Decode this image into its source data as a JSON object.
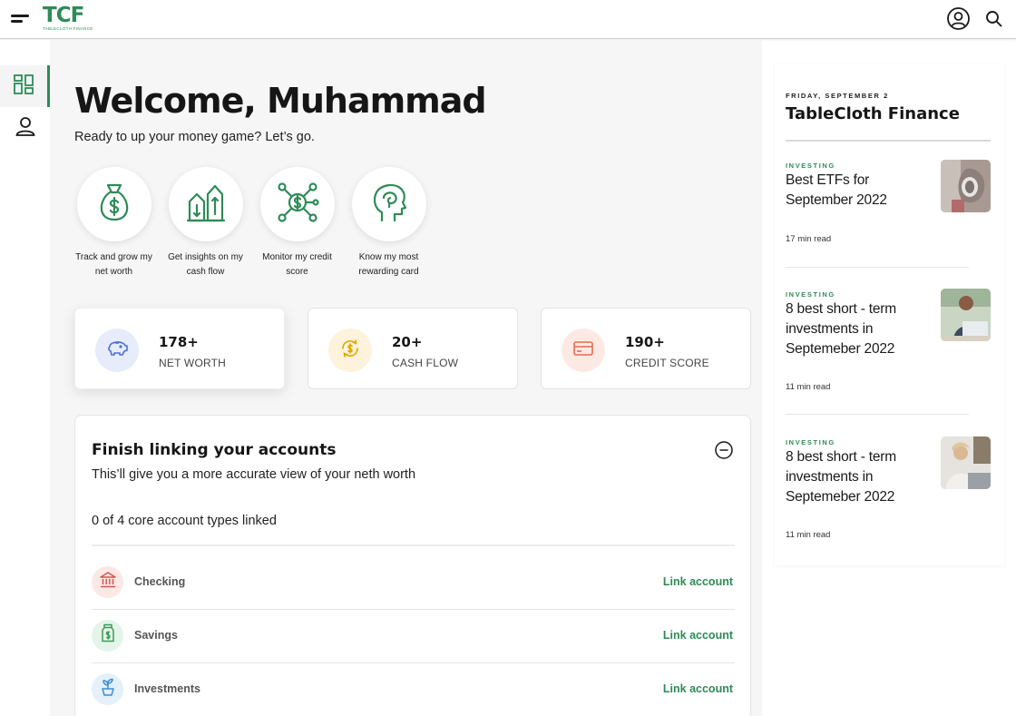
{
  "header": {
    "logo_text": "TCF",
    "logo_subtext": "TABLECLOTH FINANCE"
  },
  "sidebar": {
    "items": [
      {
        "icon": "dashboard-icon",
        "active": true
      },
      {
        "icon": "user-icon",
        "active": false
      }
    ]
  },
  "main": {
    "welcome": "Welcome, Muhammad",
    "subtitle": "Ready to up your money game? Let’s go.",
    "features": [
      {
        "icon": "money-bag-icon",
        "label": "Track and grow my net worth"
      },
      {
        "icon": "buildings-growth-icon",
        "label": "Get insights on my cash flow"
      },
      {
        "icon": "coin-network-icon",
        "label": "Monitor my credit score"
      },
      {
        "icon": "head-brain-icon",
        "label": "Know my most rewarding card"
      }
    ],
    "stats": [
      {
        "value": "178+",
        "label": "NET WORTH",
        "icon": "piggy-bank-icon",
        "color": "#4a6fd6",
        "bg": "#e7ecfa"
      },
      {
        "value": "20+",
        "label": "CASH FLOW",
        "icon": "coin-cycle-icon",
        "color": "#e0a800",
        "bg": "#fdf3dc"
      },
      {
        "value": "190+",
        "label": "CREDIT SCORE",
        "icon": "credit-card-icon",
        "color": "#e56a4f",
        "bg": "#fde9e4"
      }
    ]
  },
  "linking": {
    "title": "Finish linking your accounts",
    "subtitle": "This’ll give you a more accurate view of your neth worth",
    "progress": "0 of 4 core account types linked",
    "accounts": [
      {
        "name": "Checking",
        "action": "Link account",
        "icon": "bank-icon",
        "color": "#d9534f",
        "bg": "#fde8e6"
      },
      {
        "name": "Savings",
        "action": "Link account",
        "icon": "money-jar-icon",
        "color": "#3d9a5c",
        "bg": "#e5f4e8"
      },
      {
        "name": "Investments",
        "action": "Link account",
        "icon": "plant-growth-icon",
        "color": "#3b8fd0",
        "bg": "#e4f0fa"
      }
    ]
  },
  "news": {
    "date": "FRIDAY, SEPTEMBER 2",
    "title": "TableCloth Finance",
    "articles": [
      {
        "category": "INVESTING",
        "title": "Best ETFs for September 2022",
        "meta": "17 min read"
      },
      {
        "category": "INVESTING",
        "title": "8 best short - term investments in Septemeber 2022",
        "meta": "11 min read"
      },
      {
        "category": "INVESTING",
        "title": "8 best short - term investments in Septemeber 2022",
        "meta": "11 min read"
      }
    ]
  },
  "colors": {
    "brand": "#2e8b57",
    "background": "#f6f6f6"
  }
}
